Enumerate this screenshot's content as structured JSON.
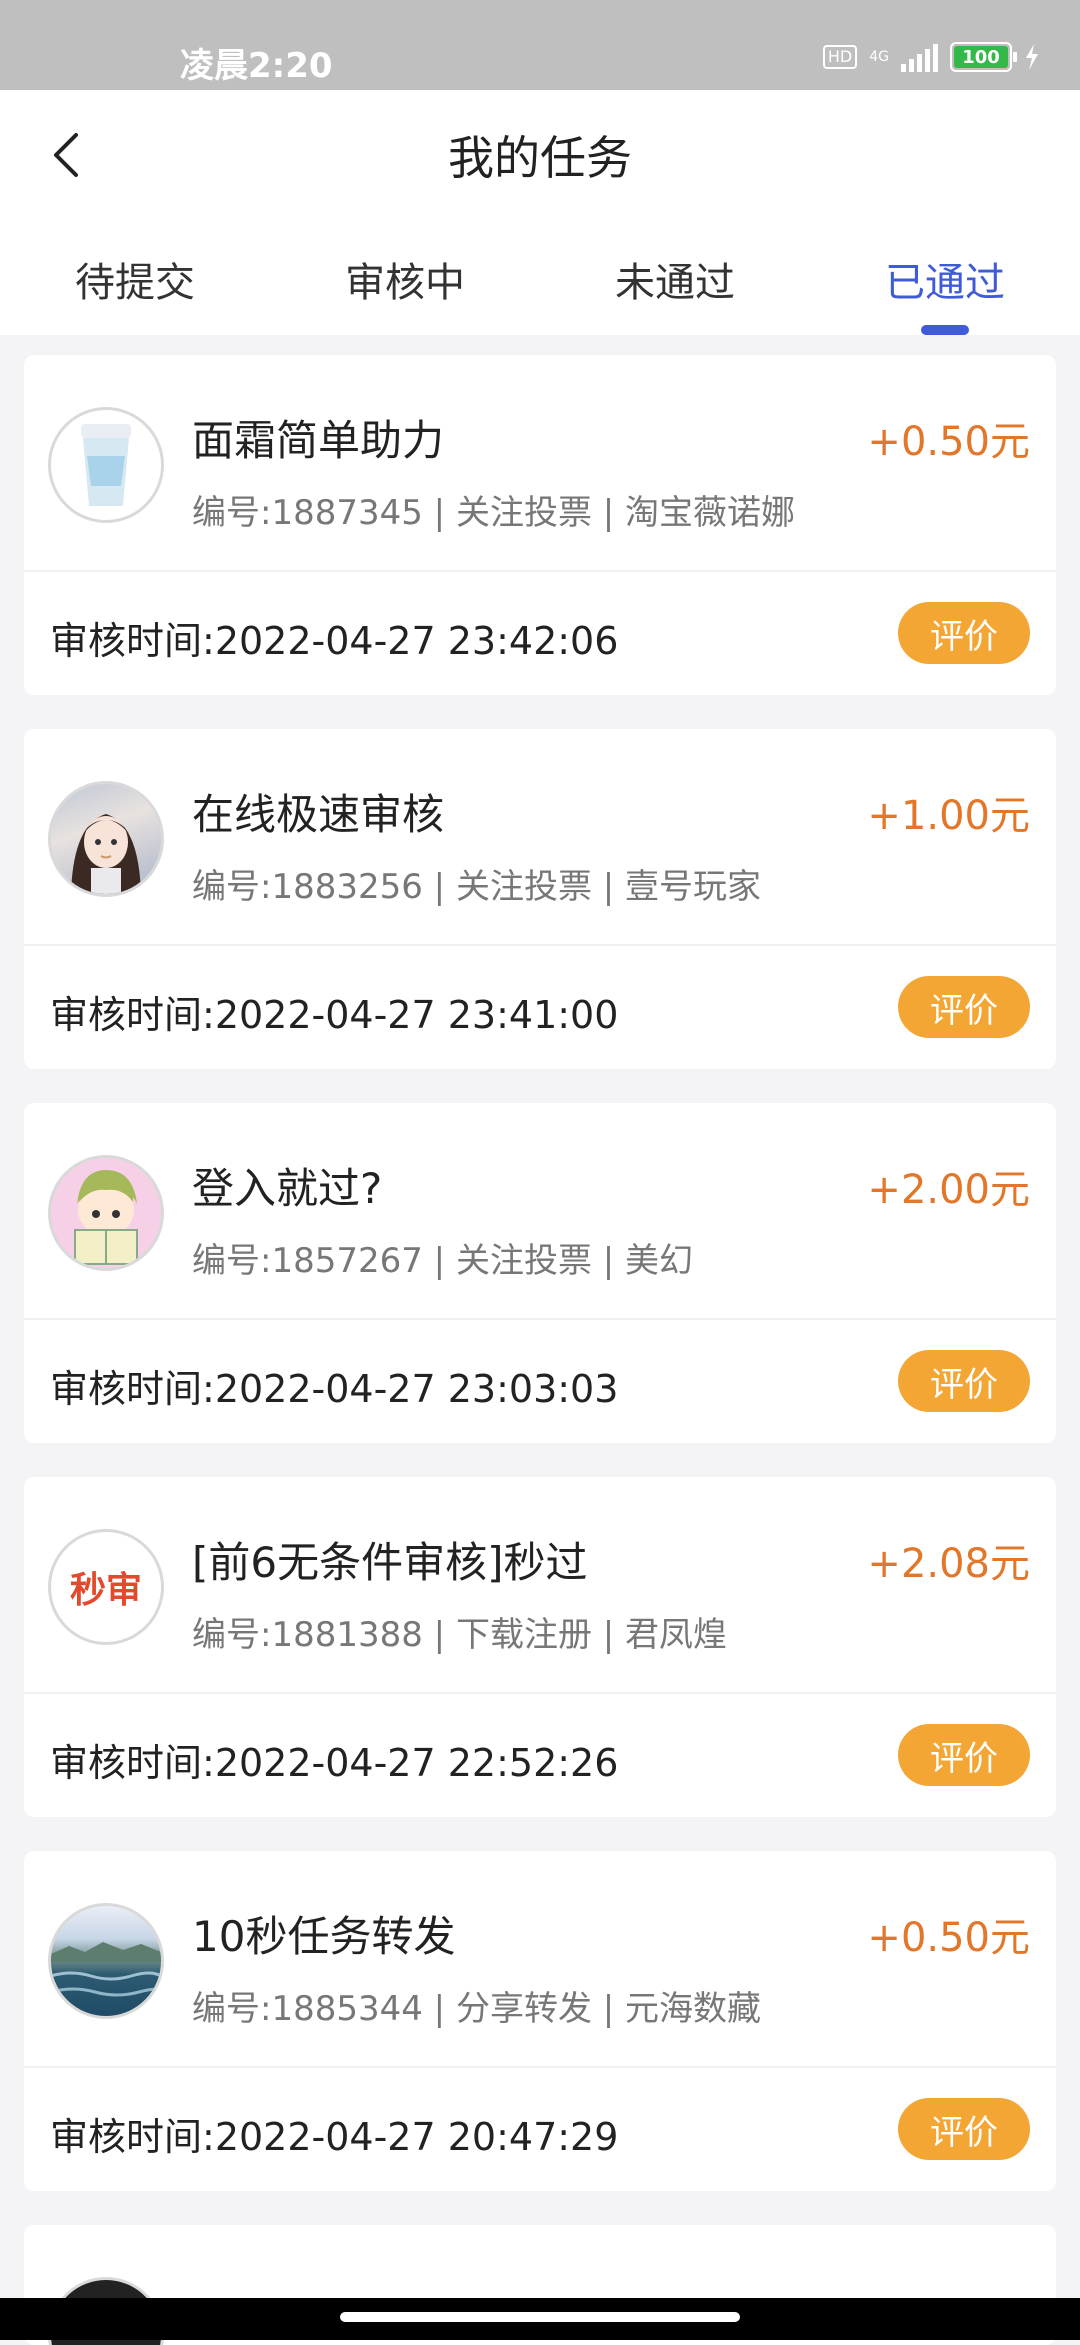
{
  "status_bar": {
    "time": "凌晨2:20",
    "hd": "HD",
    "network": "4G",
    "battery": "100"
  },
  "header": {
    "title": "我的任务"
  },
  "tabs": [
    {
      "label": "待提交"
    },
    {
      "label": "审核中"
    },
    {
      "label": "未通过"
    },
    {
      "label": "已通过"
    }
  ],
  "active_tab": "已通过",
  "review_label": "审核时间:",
  "rate_label": "评价",
  "tasks": [
    {
      "name": "面霜简单助力",
      "price": "+0.50元",
      "meta": "编号:1887345 | 关注投票 | 淘宝薇诺娜",
      "review_time": "2022-04-27 23:42:06"
    },
    {
      "name": "在线极速审核",
      "price": "+1.00元",
      "meta": "编号:1883256 | 关注投票 | 壹号玩家",
      "review_time": "2022-04-27 23:41:00"
    },
    {
      "name": "登入就过?",
      "price": "+2.00元",
      "meta": "编号:1857267 | 关注投票 | 美幻",
      "review_time": "2022-04-27 23:03:03"
    },
    {
      "name": "[前6无条件审核]秒过",
      "price": "+2.08元",
      "meta": "编号:1881388 | 下载注册 | 君凤煌",
      "review_time": "2022-04-27 22:52:26",
      "logo_text": "秒审"
    },
    {
      "name": "10秒任务转发",
      "price": "+0.50元",
      "meta": "编号:1885344 | 分享转发 | 元海数藏",
      "review_time": "2022-04-27 20:47:29"
    }
  ],
  "colors": {
    "accent": "#3f5bd9",
    "price": "#e2772a",
    "button": "#f3a634",
    "background": "#f4f4f6"
  }
}
